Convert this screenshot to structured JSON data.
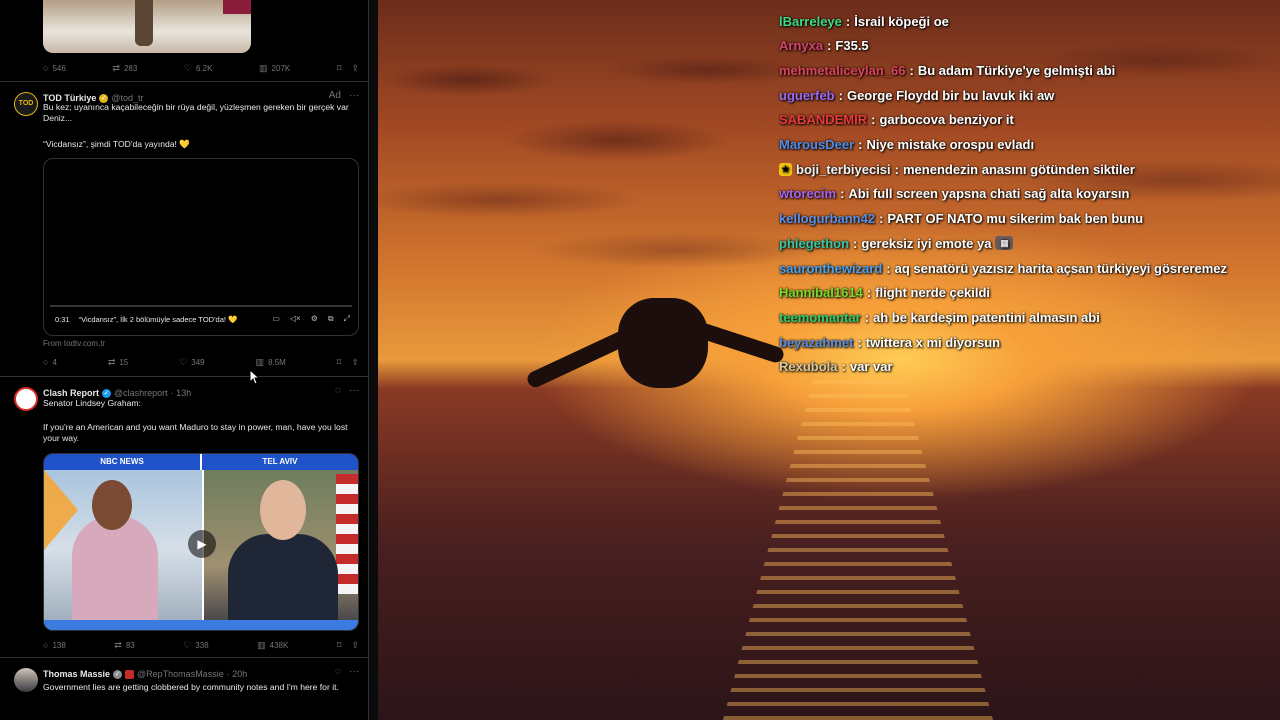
{
  "feed": {
    "post1": {
      "actions": {
        "replies": "546",
        "reposts": "283",
        "likes": "6.2K",
        "views": "207K"
      }
    },
    "post2": {
      "name": "TOD Türkiye",
      "handle": "@tod_tr",
      "ad_label": "Ad",
      "more": "···",
      "avatar_text": "TOD",
      "text1": "Bu kez; uyanınca kaçabileceğin bir rüya değil, yüzleşmen gereken bir gerçek var Deniz...",
      "text2": "“Vicdansız”, şimdi TOD'da yayında! 💛",
      "video": {
        "time": "0:31",
        "caption": "“Vicdansız”, İlk 2 bölümüyle sadece TOD'da! 💛"
      },
      "source": "From todtv.com.tr",
      "actions": {
        "replies": "4",
        "reposts": "15",
        "likes": "349",
        "views": "8.5M"
      }
    },
    "post3": {
      "name": "Clash Report",
      "handle": "@clashreport",
      "time": "· 13h",
      "more": "···",
      "text1": "Senator Lindsey Graham:",
      "text2": "If you're an American and you want Maduro to stay in power, man, have you lost your way.",
      "image": {
        "left_label": "NBC NEWS",
        "right_label": "TEL AVIV"
      },
      "actions": {
        "replies": "138",
        "reposts": "83",
        "likes": "338",
        "views": "438K"
      }
    },
    "post4": {
      "name": "Thomas Massie",
      "handle": "@RepThomasMassie",
      "time": "· 20h",
      "more": "···",
      "text": "Government lies are getting clobbered by community notes and I'm here for it."
    }
  },
  "chat": [
    {
      "user": "lBarreleye",
      "color": "#3ddc84",
      "text": "İsrail köpeği oe"
    },
    {
      "user": "Arnyxa",
      "color": "#d6456f",
      "text": "F35.5"
    },
    {
      "user": "mehmetaliceylan_66",
      "color": "#e0445a",
      "text": "Bu adam Türkiye'ye gelmişti abi"
    },
    {
      "user": "uguerfeb",
      "color": "#9b6cf2",
      "text": "George Floydd bir bu lavuk iki aw"
    },
    {
      "user": "SABANDEMIR",
      "color": "#e83a3a",
      "text": "garbocova benziyor it"
    },
    {
      "user": "MarousDeer",
      "color": "#4f8ee8",
      "text": "Niye mistake orospu evladı"
    },
    {
      "user": "boji_terbiyecisi",
      "color": "#f2f2f2",
      "text": "menendezin anasını götünden siktiler",
      "badge": true
    },
    {
      "user": "wtorecim",
      "color": "#a565f2",
      "text": "Abi full screen yapsna chati sağ alta koyarsın"
    },
    {
      "user": "kellogurbann42",
      "color": "#5d8fe6",
      "text": "PART OF NATO mu sikerim bak ben bunu"
    },
    {
      "user": "phlegethon",
      "color": "#35c7a6",
      "text": "gereksiz iyi emote ya",
      "emote": true
    },
    {
      "user": "sauronthewizard",
      "color": "#4aa3f0",
      "text": "aq senatörü yazısız harita açsan türkiyeyi gösreremez"
    },
    {
      "user": "Hannibal1614",
      "color": "#7cdc2e",
      "text": "flight nerde çekildi"
    },
    {
      "user": "teemomantar",
      "color": "#2ecc71",
      "text": "ah be kardeşim patentini almasın abi"
    },
    {
      "user": "beyazahmet",
      "color": "#5c8fe0",
      "text": "twittera x mi diyorsun"
    },
    {
      "user": "Rexubola",
      "color": "#d8c7a0",
      "text": "var var"
    }
  ],
  "icons": {
    "reply": "💬",
    "repost": "⇄",
    "like": "♡",
    "views": "▮▮",
    "bookmark": "⌑",
    "share": "⇪",
    "play": "▶"
  }
}
